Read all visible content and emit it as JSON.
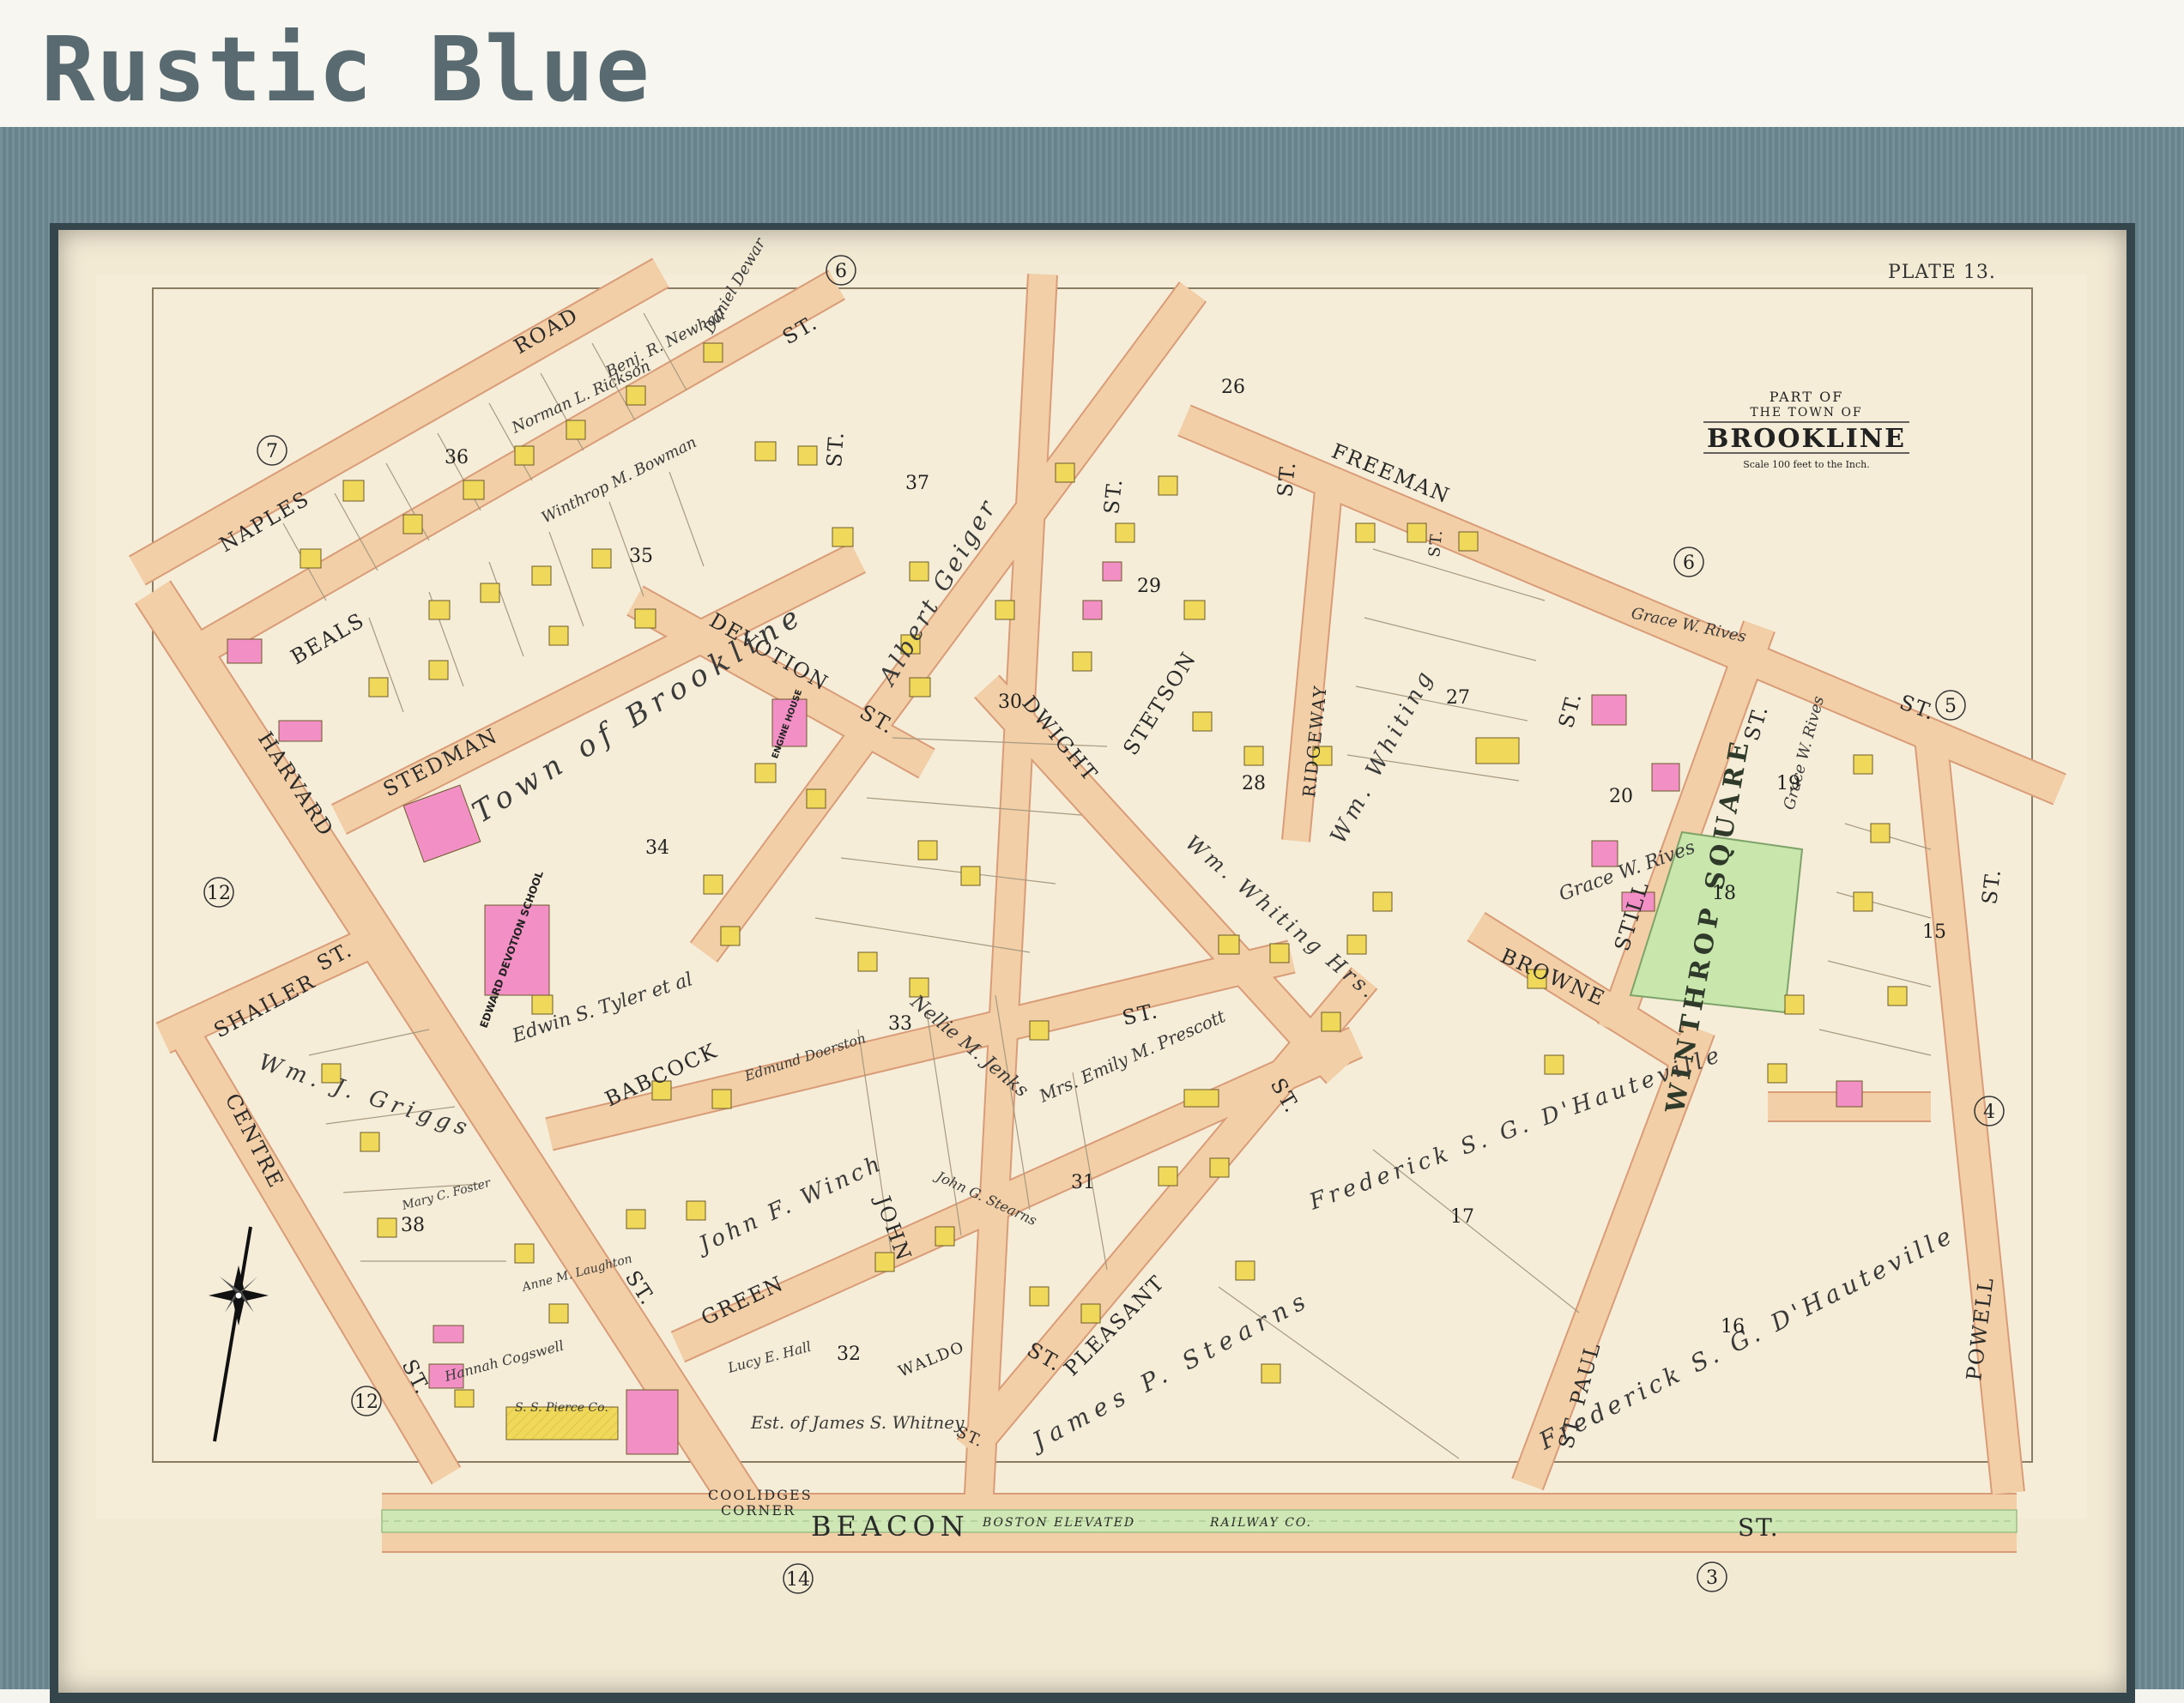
{
  "banner": {
    "title": "Rustic Blue"
  },
  "plate": {
    "label": "PLATE 13."
  },
  "cartouche": {
    "part_of": "PART OF",
    "the_town_of": "THE TOWN OF",
    "town": "BROOKLINE",
    "scale": "Scale 100 feet to the Inch."
  },
  "colors": {
    "frame": "#6e8a93",
    "paper": "#f3ead4",
    "road": "#f2cfa6",
    "road_edge": "#d99c78",
    "house_yellow": "#f0d95a",
    "house_pink": "#f28fc4",
    "park_green": "#c9e6ad",
    "rail_green": "#cfe7b4",
    "title_gray": "#5a6a71"
  },
  "streets": {
    "naples": "NAPLES",
    "road": "ROAD",
    "beals": "BEALS",
    "harvard": "HARVARD",
    "stedman": "STEDMAN",
    "devotion": "DEVOTION",
    "st_devotion": "ST.",
    "shailer": "SHAILER",
    "st_shailer": "ST.",
    "centre": "CENTRE",
    "st_centre": "ST.",
    "st_harvard": "ST.",
    "babcock": "BABCOCK",
    "st_babcock": "ST.",
    "green": "GREEN",
    "john": "JOHN",
    "st_john": "ST.",
    "waldo": "WALDO",
    "st_waldo": "ST.",
    "pleasant": "PLEASANT",
    "st_pleasant": "ST.",
    "dwight": "DWIGHT",
    "st_top1": "ST.",
    "st_top2": "ST.",
    "stetson": "STETSON",
    "st_stetson": "ST.",
    "freeman": "FREEMAN",
    "st_freeman": "ST.",
    "ridgeway": "RIDGEWAY",
    "browne": "BROWNE",
    "st_browne": "ST.",
    "still": "STILL",
    "st_still": "ST.",
    "st_paul": "ST. PAUL",
    "powell": "POWELL",
    "st_powell": "ST.",
    "st_east": "ST.",
    "st_east2": "ST.",
    "beacon": "BEACON",
    "st_beacon": "ST.",
    "boston_elevated": "BOSTON ELEVATED",
    "railway_co": "RAILWAY  CO.",
    "coolidges": "COOLIDGES",
    "corner": "CORNER"
  },
  "plate_refs": [
    "6",
    "7",
    "12",
    "12",
    "6",
    "5",
    "4",
    "3",
    "14"
  ],
  "blocks": [
    "36",
    "35",
    "37",
    "26",
    "29",
    "30",
    "34",
    "28",
    "27",
    "20",
    "19",
    "18",
    "15",
    "33",
    "31",
    "17",
    "38",
    "32",
    "16"
  ],
  "parcel_labels": [
    "Town of Brookline",
    "Edwin S. Tyler et al",
    "Wm. J. Griggs",
    "John F. Winch",
    "Albert Geiger",
    "Wm. Whiting",
    "Wm. Whiting Hrs.",
    "Grace W. Rives",
    "Grace W. Rives",
    "Grace W. Rives",
    "Frederick S. G. D'Hauteville",
    "Frederick S. G. D'Hauteville",
    "James P. Stearns",
    "Est. of James S. Whitney",
    "Mrs. Emily M. Prescott",
    "John G. Stearns",
    "Norman L. Rickson",
    "Winthrop M. Bowman",
    "Benj. R. Newhall",
    "Daniel Dewar",
    "Nellie M. Jenks",
    "Lucy E. Hall",
    "Mary C. Foster",
    "Anne M. Laughton",
    "Hannah Cogswell",
    "S. S. Pierce Co.",
    "Edmund Doerston"
  ],
  "buildings": {
    "school": "EDWARD DEVOTION SCHOOL",
    "engine_house": "ENGINE HOUSE"
  },
  "park": {
    "name": "WINTHROP SQUARE"
  }
}
